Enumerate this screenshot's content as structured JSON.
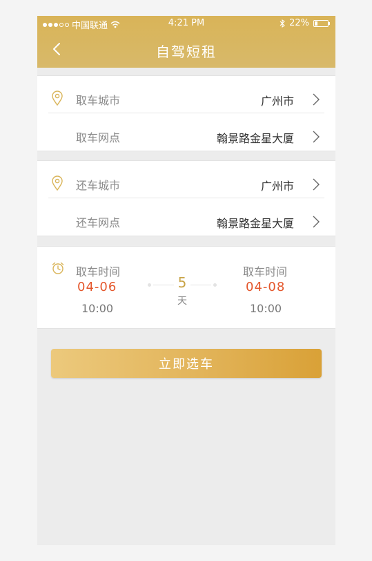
{
  "status_bar": {
    "carrier": "中国联通",
    "time": "4:21 PM",
    "battery": "22%",
    "battery_level": 0.22
  },
  "nav": {
    "title": "自驾短租",
    "back_icon": "chevron-left-icon"
  },
  "pickup": {
    "icon": "location-pin-icon",
    "city_label": "取车城市",
    "city_value": "广州市",
    "branch_label": "取车网点",
    "branch_value": "翰景路金星大厦"
  },
  "return": {
    "icon": "location-pin-icon",
    "city_label": "还车城市",
    "city_value": "广州市",
    "branch_label": "还车网点",
    "branch_value": "翰景路金星大厦"
  },
  "time": {
    "icon": "alarm-clock-icon",
    "start_label": "取车时间",
    "start_date": "04-06",
    "start_hour": "10:00",
    "days": "5",
    "days_unit": "天",
    "end_label": "取车时间",
    "end_date": "04-08",
    "end_hour": "10:00"
  },
  "cta": {
    "label": "立即选车"
  },
  "colors": {
    "brand_gold": "#d9b458",
    "date_orange": "#e4572c"
  }
}
